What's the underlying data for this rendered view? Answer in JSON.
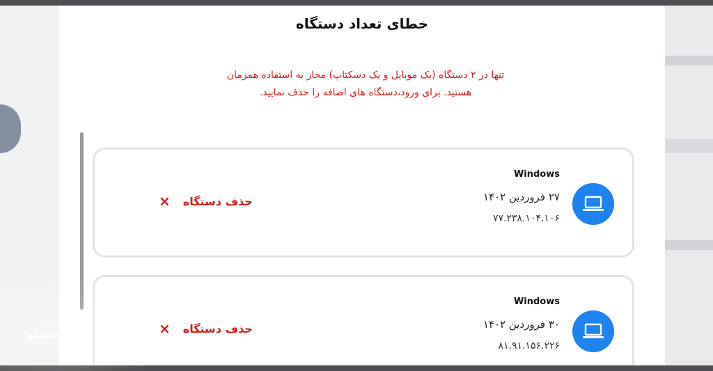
{
  "modal": {
    "title": "خطای تعداد دستگاه",
    "message_line1": "تنها در ۲ دستگاه (یک موبایل و یک دسکتاپ) مجاز به استفاده همزمان",
    "message_line2": "هستید. برای ورود،دستگاه های اضافه را حذف نمایید."
  },
  "devices": [
    {
      "os": "Windows",
      "date": "۲۷ فروردین ۱۴۰۲",
      "ip": "۷۷.۲۳۸.۱۰۴.۱۰۶",
      "remove_label": "حذف دستگاه",
      "remove_icon": "×"
    },
    {
      "os": "Windows",
      "date": "۳۰ فروردین ۱۴۰۲",
      "ip": "۸۱.۹۱.۱۵۶.۲۲۶",
      "remove_label": "حذف دستگاه",
      "remove_icon": "×"
    }
  ],
  "watermark": {
    "text": "رسمیو"
  },
  "colors": {
    "accent": "#1e82f0",
    "danger": "#cf1f1f"
  },
  "icons": {
    "device": "laptop-icon",
    "remove": "close-icon",
    "watermark": "logo-icon"
  }
}
